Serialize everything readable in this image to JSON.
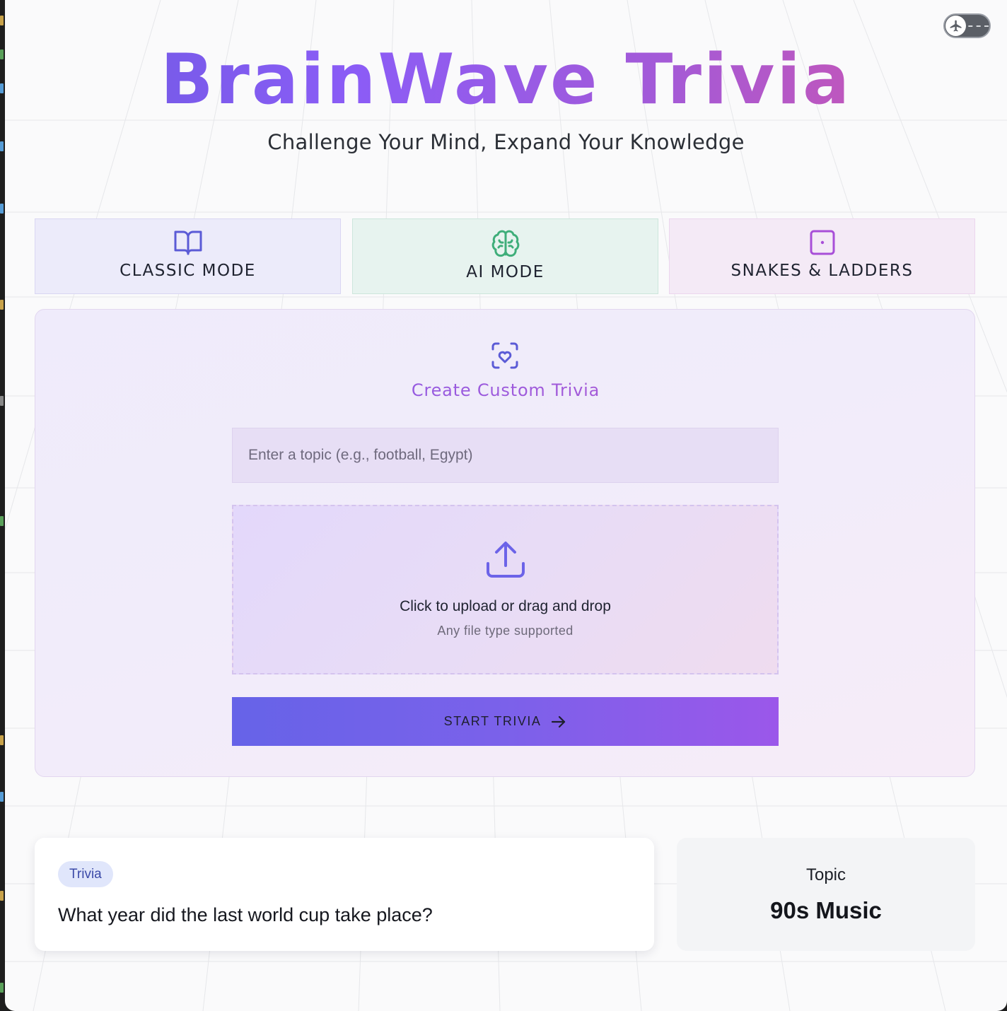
{
  "app": {
    "title": "BrainWave Trivia",
    "subtitle": "Challenge Your Mind, Expand Your Knowledge"
  },
  "theme_toggle": {
    "icon": "airplane-icon"
  },
  "modes": [
    {
      "label": "CLASSIC MODE",
      "icon": "book-icon",
      "color": "#5b5bd6"
    },
    {
      "label": "AI MODE",
      "icon": "brain-icon",
      "color": "#3fae7a"
    },
    {
      "label": "SNAKES & LADDERS",
      "icon": "dice-icon",
      "color": "#a84fd8"
    }
  ],
  "custom": {
    "icon": "heart-scan-icon",
    "title": "Create Custom Trivia",
    "topic_placeholder": "Enter a topic (e.g., football, Egypt)",
    "topic_value": "",
    "upload_icon": "upload-icon",
    "upload_main": "Click to upload or drag and drop",
    "upload_sub": "Any file type supported",
    "start_label": "START TRIVIA",
    "start_icon": "arrow-right-icon"
  },
  "question_card": {
    "badge": "Trivia",
    "question": "What year did the last world cup take place?"
  },
  "topic_card": {
    "label": "Topic",
    "value": "90s Music"
  },
  "colors": {
    "accent_start": "#6a5ae0",
    "accent_end": "#d454a8",
    "button_start": "#6663e8",
    "button_end": "#9b57ea"
  }
}
